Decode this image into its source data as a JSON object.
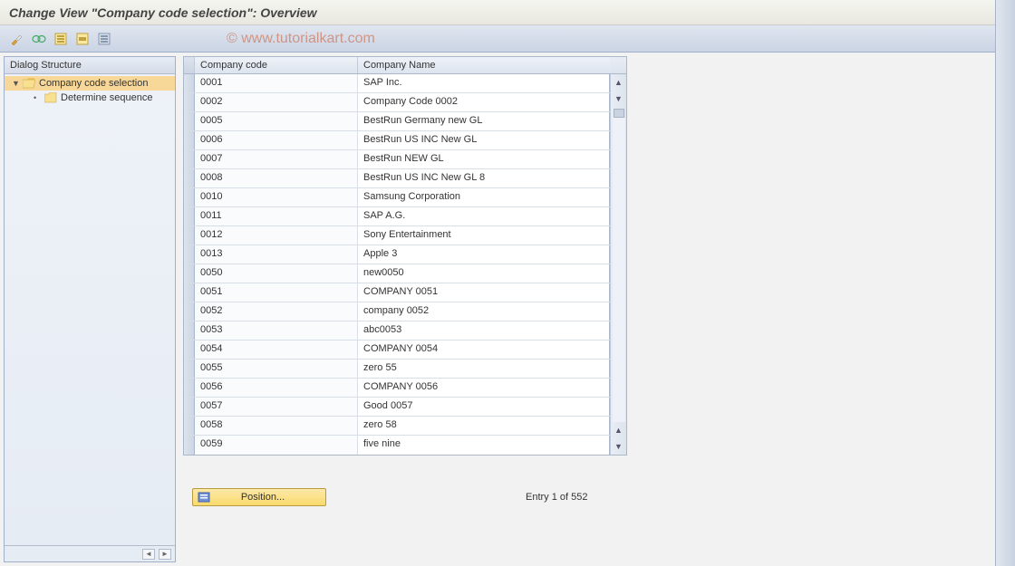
{
  "title": "Change View \"Company code selection\": Overview",
  "watermark": "© www.tutorialkart.com",
  "toolbar": {
    "buttons": [
      "display-change",
      "glasses",
      "select-all",
      "select-block",
      "deselect-all"
    ]
  },
  "tree": {
    "header": "Dialog Structure",
    "items": [
      {
        "label": "Company code selection",
        "expanded": true,
        "selected": true,
        "folder": "open"
      },
      {
        "label": "Determine sequence",
        "child": true,
        "folder": "closed"
      }
    ]
  },
  "table": {
    "columns": [
      "Company code",
      "Company Name"
    ],
    "rows": [
      {
        "code": "0001",
        "name": "SAP Inc."
      },
      {
        "code": "0002",
        "name": "Company Code 0002"
      },
      {
        "code": "0005",
        "name": "BestRun Germany new GL"
      },
      {
        "code": "0006",
        "name": "BestRun US INC New GL"
      },
      {
        "code": "0007",
        "name": "BestRun NEW GL"
      },
      {
        "code": "0008",
        "name": "BestRun US INC New GL 8"
      },
      {
        "code": "0010",
        "name": "Samsung Corporation"
      },
      {
        "code": "0011",
        "name": "SAP A.G."
      },
      {
        "code": "0012",
        "name": "Sony Entertainment"
      },
      {
        "code": "0013",
        "name": "Apple 3"
      },
      {
        "code": "0050",
        "name": "new0050"
      },
      {
        "code": "0051",
        "name": "COMPANY 0051"
      },
      {
        "code": "0052",
        "name": "company 0052"
      },
      {
        "code": "0053",
        "name": "abc0053"
      },
      {
        "code": "0054",
        "name": "COMPANY 0054"
      },
      {
        "code": "0055",
        "name": "zero 55"
      },
      {
        "code": "0056",
        "name": "COMPANY 0056"
      },
      {
        "code": "0057",
        "name": "Good 0057"
      },
      {
        "code": "0058",
        "name": "zero 58"
      },
      {
        "code": "0059",
        "name": "five nine"
      }
    ]
  },
  "footer": {
    "position_label": "Position...",
    "entry_text": "Entry 1 of 552"
  }
}
